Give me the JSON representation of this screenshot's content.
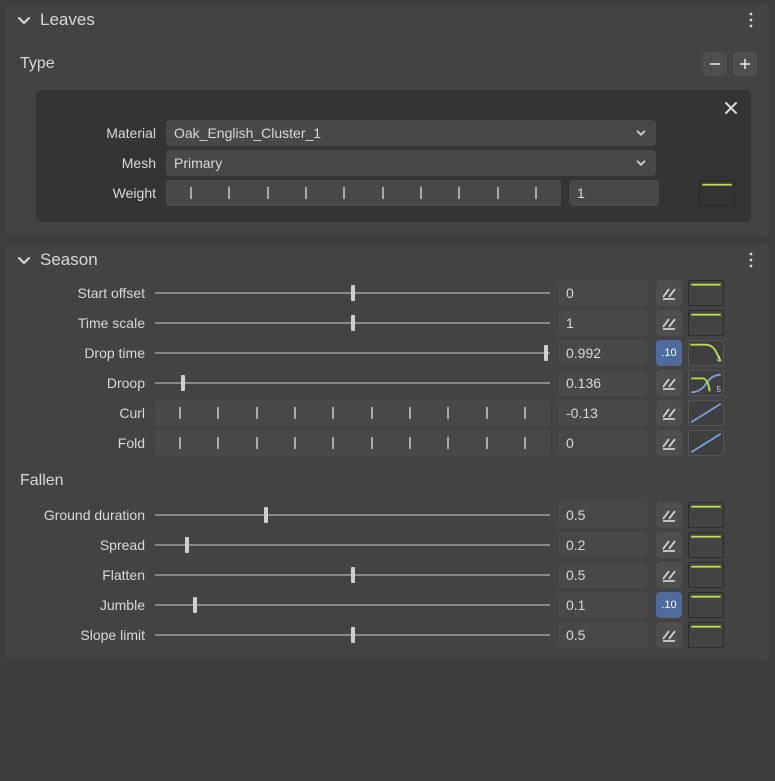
{
  "leaves_panel": {
    "title": "Leaves",
    "type_section": {
      "label": "Type",
      "material_label": "Material",
      "material_value": "Oak_English_Cluster_1",
      "mesh_label": "Mesh",
      "mesh_value": "Primary",
      "weight_label": "Weight",
      "weight_value": "1"
    }
  },
  "season_panel": {
    "title": "Season",
    "rows": {
      "start_offset": {
        "label": "Start offset",
        "value": "0",
        "pos": 0.5,
        "action": "variance",
        "curve": "flat-top"
      },
      "time_scale": {
        "label": "Time scale",
        "value": "1",
        "pos": 0.5,
        "action": "variance",
        "curve": "flat-top"
      },
      "drop_time": {
        "label": "Drop time",
        "value": "0.992",
        "pos": 0.99,
        "action": "s10",
        "curve": "num-4"
      },
      "droop": {
        "label": "Droop",
        "value": "0.136",
        "pos": 0.07,
        "action": "variance",
        "curve": "num-5-blue"
      },
      "curl": {
        "label": "Curl",
        "value": "-0.13",
        "pos": null,
        "action": "variance",
        "curve": "diag-blue"
      },
      "fold": {
        "label": "Fold",
        "value": "0",
        "pos": null,
        "action": "variance",
        "curve": "diag-blue"
      }
    },
    "fallen": {
      "title": "Fallen",
      "rows": {
        "ground_duration": {
          "label": "Ground duration",
          "value": "0.5",
          "pos": 0.28,
          "action": "variance",
          "curve": "flat-top"
        },
        "spread": {
          "label": "Spread",
          "value": "0.2",
          "pos": 0.08,
          "action": "variance",
          "curve": "flat-top"
        },
        "flatten": {
          "label": "Flatten",
          "value": "0.5",
          "pos": 0.5,
          "action": "variance",
          "curve": "flat-top"
        },
        "jumble": {
          "label": "Jumble",
          "value": "0.1",
          "pos": 0.1,
          "action": "s10",
          "curve": "flat-top"
        },
        "slope_limit": {
          "label": "Slope limit",
          "value": "0.5",
          "pos": 0.5,
          "action": "variance",
          "curve": "flat-top"
        }
      }
    }
  },
  "glyphs": {
    "s10": ".10"
  }
}
